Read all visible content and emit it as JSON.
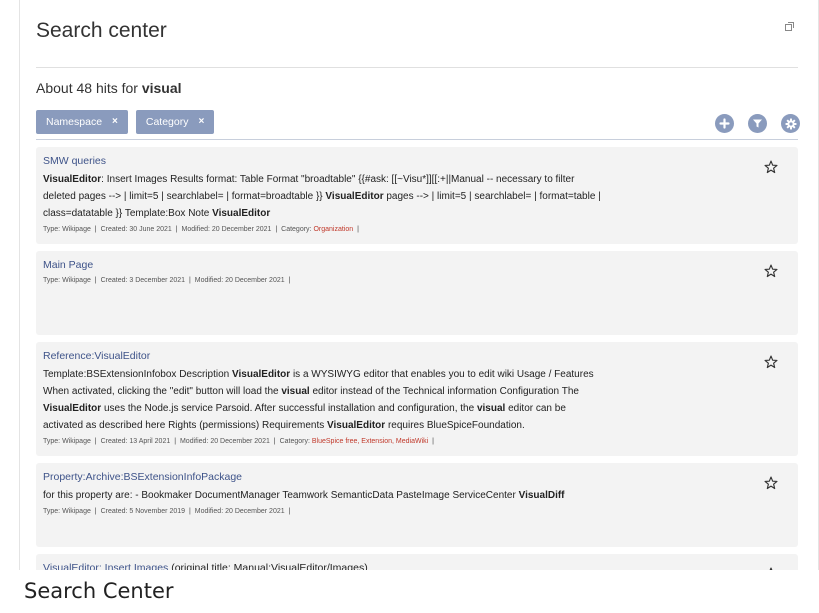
{
  "panel": {
    "title": "Search center",
    "hits_prefix": "About 48 hits for ",
    "query": "visual"
  },
  "filters": [
    {
      "label": "Namespace",
      "remove": "×"
    },
    {
      "label": "Category",
      "remove": "×"
    }
  ],
  "tools": [
    {
      "icon": "plus-circle-icon"
    },
    {
      "icon": "filter-icon"
    },
    {
      "icon": "gear-icon"
    }
  ],
  "results": [
    {
      "title": "SMW queries",
      "snippet": [
        {
          "t": "VisualEditor",
          "b": true
        },
        {
          "t": ": Insert Images Results format: Table Format \"broadtable\" {{#ask: [[~Visu*]][[:+||Manual -- necessary to filter deleted pages --> | limit=5 | searchlabel= | format=broadtable }} ",
          "b": false
        },
        {
          "t": "VisualEditor",
          "b": true
        },
        {
          "t": " pages --> | limit=5 | searchlabel= | format=table | class=datatable }} Template:Box Note ",
          "b": false
        },
        {
          "t": "VisualEditor",
          "b": true
        }
      ],
      "meta": [
        {
          "t": "Type: Wikipage"
        },
        {
          "t": "Created: 30 June 2021"
        },
        {
          "t": "Modified: 20 December 2021"
        },
        {
          "t": "Category: ",
          "cat": "Organization"
        }
      ],
      "min_height": 95
    },
    {
      "title": "Main Page",
      "snippet": [],
      "meta": [
        {
          "t": "Type: Wikipage"
        },
        {
          "t": "Created: 3 December 2021"
        },
        {
          "t": "Modified: 20 December 2021"
        }
      ],
      "min_height": 84
    },
    {
      "title": "Reference:VisualEditor",
      "snippet": [
        {
          "t": "Template:BSExtensionInfobox Description ",
          "b": false
        },
        {
          "t": "VisualEditor",
          "b": true
        },
        {
          "t": " is a WYSIWYG editor that enables you to edit wiki Usage / Features When activated, clicking the \"edit\" button will load the ",
          "b": false
        },
        {
          "t": "visual",
          "b": true
        },
        {
          "t": " editor instead of the Technical information Configuration The ",
          "b": false
        },
        {
          "t": "VisualEditor",
          "b": true
        },
        {
          "t": " uses the Node.js service Parsoid. After successful installation and configuration, the ",
          "b": false
        },
        {
          "t": "visual",
          "b": true
        },
        {
          "t": " editor can be activated as described here Rights (permissions) Requirements ",
          "b": false
        },
        {
          "t": "VisualEditor",
          "b": true
        },
        {
          "t": " requires BlueSpiceFoundation.",
          "b": false
        }
      ],
      "meta": [
        {
          "t": "Type: Wikipage"
        },
        {
          "t": "Created: 13 April 2021"
        },
        {
          "t": "Modified: 20 December 2021"
        },
        {
          "t": "Category: ",
          "cat": "BlueSpice free, Extension, MediaWiki"
        }
      ],
      "min_height": 110
    },
    {
      "title": "Property:Archive:BSExtensionInfoPackage",
      "snippet": [
        {
          "t": "for this property are: - Bookmaker DocumentManager Teamwork SemanticData PasteImage ServiceCenter ",
          "b": false
        },
        {
          "t": "VisualDiff",
          "b": true
        }
      ],
      "meta": [
        {
          "t": "Type: Wikipage"
        },
        {
          "t": "Created: 5 November 2019"
        },
        {
          "t": "Modified: 20 December 2021"
        }
      ],
      "min_height": 84
    },
    {
      "title": "VisualEditor: Insert Images",
      "title_suffix": " (original title: Manual:VisualEditor/Images)",
      "snippet": [],
      "meta": [],
      "min_height": 40
    }
  ],
  "caption": "Search Center"
}
